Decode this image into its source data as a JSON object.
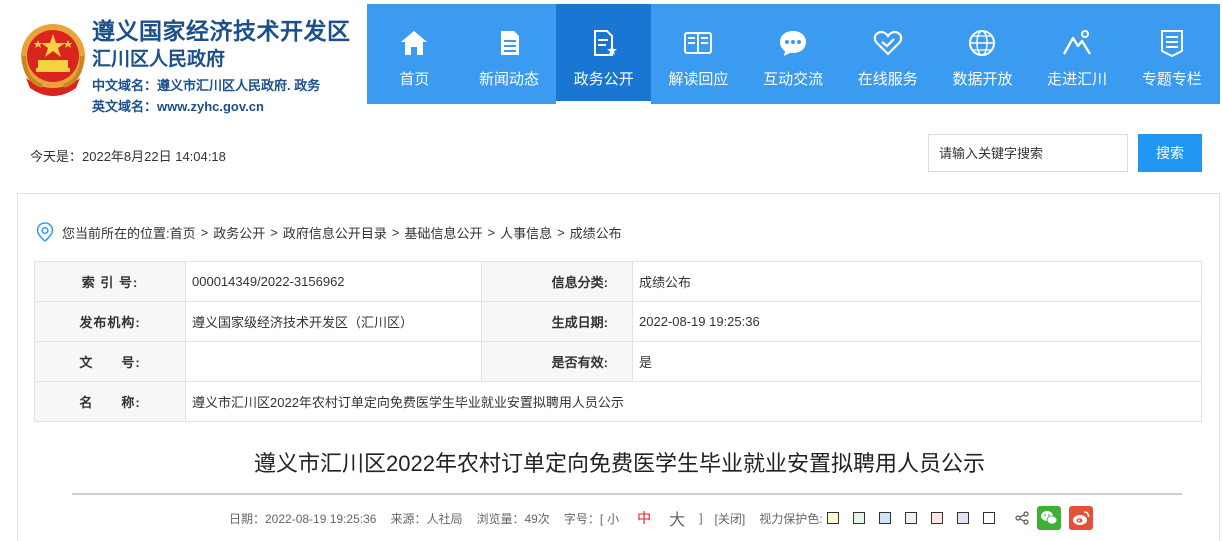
{
  "header": {
    "title": "遵义国家经济技术开发区",
    "subtitle": "汇川区人民政府",
    "domain_cn": "中文域名：遵义市汇川区人民政府. 政务",
    "domain_en": "英文域名：www.zyhc.gov.cn"
  },
  "nav": {
    "items": [
      {
        "label": "首页",
        "icon": "home-icon"
      },
      {
        "label": "新闻动态",
        "icon": "news-icon"
      },
      {
        "label": "政务公开",
        "icon": "document-icon",
        "active": true
      },
      {
        "label": "解读回应",
        "icon": "book-icon"
      },
      {
        "label": "互动交流",
        "icon": "chat-icon"
      },
      {
        "label": "在线服务",
        "icon": "handshake-icon"
      },
      {
        "label": "数据开放",
        "icon": "globe-icon"
      },
      {
        "label": "走进汇川",
        "icon": "mountain-icon"
      },
      {
        "label": "专题专栏",
        "icon": "list-icon"
      }
    ]
  },
  "today": "今天是：2022年8月22日 14:04:18",
  "search": {
    "placeholder": "请输入关键字搜索",
    "button_label": "搜索"
  },
  "breadcrumb": {
    "prefix": "您当前所在的位置:",
    "items": [
      "首页",
      "政务公开",
      "政府信息公开目录",
      "基础信息公开",
      "人事信息",
      "成绩公布"
    ],
    "separator": ">"
  },
  "info": {
    "index_label": "索 引 号:",
    "index_value": "000014349/2022-3156962",
    "category_label": "信息分类:",
    "category_value": "成绩公布",
    "publisher_label": "发布机构:",
    "publisher_value": "遵义国家级经济技术开发区（汇川区）",
    "date_label": "生成日期:",
    "date_value": "2022-08-19 19:25:36",
    "doc_label": "文　　号:",
    "doc_value": "",
    "valid_label": "是否有效:",
    "valid_value": "是",
    "name_label": "名　　称:",
    "name_value": "遵义市汇川区2022年农村订单定向免费医学生毕业就业安置拟聘用人员公示"
  },
  "article": {
    "title": "遵义市汇川区2022年农村订单定向免费医学生毕业就业安置拟聘用人员公示"
  },
  "meta": {
    "date": "日期：2022-08-19 19:25:36",
    "source": "来源：人社局",
    "views": "浏览量：49次",
    "font_label": "字号：[",
    "font_small": "小",
    "font_mid": "中",
    "font_big": "大",
    "font_close": "]",
    "close": "[关闭]",
    "eye_label": "视力保护色:",
    "swatch_colors": [
      "#fefcd2",
      "#e2f5e8",
      "#d0e6f8",
      "#f0f0f0",
      "#fde6e6",
      "#e9dff5",
      "#ffffff"
    ]
  },
  "colors": {
    "nav_bg": "#3a9bf0",
    "nav_active": "#1976d2",
    "title_blue": "#1c4f8c",
    "search_btn": "#2196f3"
  }
}
